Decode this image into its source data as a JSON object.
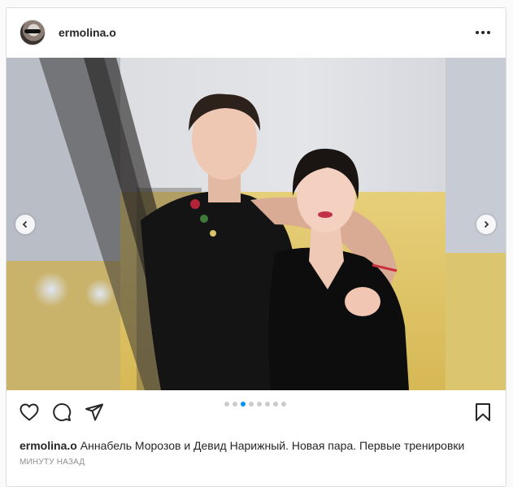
{
  "post": {
    "author": "ermolina.o",
    "photo": {
      "alt_people": 2,
      "slide_count": 8,
      "active_slide": 3
    },
    "caption_user": "ermolina.o",
    "caption_text": "Аннабель Морозов и Девид Нарижный. Новая пара. Первые тренировки",
    "timestamp": "минуту назад"
  },
  "icons": {
    "more": "more-horizontal-icon",
    "prev": "chevron-left-icon",
    "next": "chevron-right-icon",
    "like": "heart-icon",
    "comment": "comment-icon",
    "share": "paper-plane-icon",
    "save": "bookmark-icon"
  },
  "colors": {
    "accent": "#0095f6",
    "text": "#262626",
    "muted": "#8e8e8e",
    "border": "#dbdbdb"
  }
}
